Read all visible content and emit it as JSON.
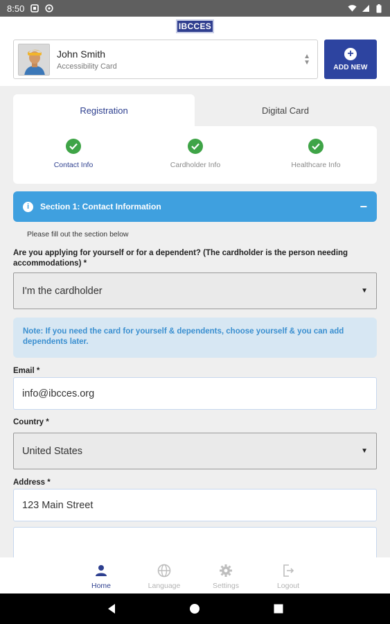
{
  "status": {
    "time": "8:50",
    "battery_icon": "battery-icon",
    "wifi_icon": "wifi-icon"
  },
  "app": {
    "logo_text": "IBCCES"
  },
  "profile": {
    "name": "John Smith",
    "subtitle": "Accessibility Card"
  },
  "add_new": {
    "label": "ADD NEW"
  },
  "tabs": [
    {
      "label": "Registration",
      "active": true
    },
    {
      "label": "Digital Card",
      "active": false
    }
  ],
  "steps": [
    {
      "label": "Contact Info",
      "active": true,
      "complete": true
    },
    {
      "label": "Cardholder Info",
      "active": false,
      "complete": true
    },
    {
      "label": "Healthcare Info",
      "active": false,
      "complete": true
    }
  ],
  "section": {
    "title": "Section 1: Contact Information",
    "hint": "Please fill out the section below"
  },
  "form": {
    "applicant_question": "Are you applying for yourself or for a dependent? (The cardholder is the person needing accommodations) *",
    "applicant_value": "I'm the cardholder",
    "note": "Note: If you need the card for yourself & dependents, choose yourself & you can add dependents later.",
    "email_label": "Email *",
    "email_value": "info@ibcces.org",
    "country_label": "Country *",
    "country_value": "United States",
    "address_label": "Address *",
    "address_value": "123 Main Street",
    "address2_value": ""
  },
  "bottom_nav": [
    {
      "label": "Home",
      "icon": "person-icon",
      "active": true
    },
    {
      "label": "Language",
      "icon": "globe-icon",
      "active": false
    },
    {
      "label": "Settings",
      "icon": "gear-icon",
      "active": false
    },
    {
      "label": "Logout",
      "icon": "logout-icon",
      "active": false
    }
  ],
  "colors": {
    "primary": "#2d44a0",
    "accent_blue": "#3fa0df",
    "success": "#3fa447",
    "note_bg": "#d7e7f3"
  }
}
